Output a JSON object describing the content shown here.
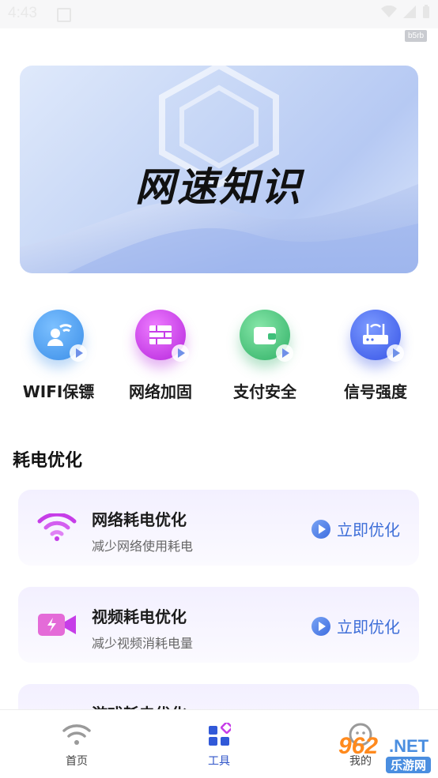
{
  "status": {
    "time": "4:43",
    "build_tag": "b5rb"
  },
  "banner": {
    "title": "网速知识"
  },
  "tools": [
    {
      "label": "WIFI保镖",
      "icon": "wifi-shield-icon",
      "color": "#4a9cf0"
    },
    {
      "label": "网络加固",
      "icon": "firewall-icon",
      "color": "#c63de8"
    },
    {
      "label": "支付安全",
      "icon": "wallet-icon",
      "color": "#3fc07a"
    },
    {
      "label": "信号强度",
      "icon": "router-icon",
      "color": "#4b6ff0"
    }
  ],
  "section": {
    "title": "耗电优化"
  },
  "cards": [
    {
      "title": "网络耗电优化",
      "subtitle": "减少网络使用耗电",
      "action": "立即优化",
      "icon": "wifi-icon"
    },
    {
      "title": "视频耗电优化",
      "subtitle": "减少视频消耗电量",
      "action": "立即优化",
      "icon": "video-icon"
    },
    {
      "title": "游戏耗电优化",
      "subtitle": "",
      "action": "",
      "icon": "game-icon"
    }
  ],
  "tabs": [
    {
      "label": "首页",
      "icon": "wifi-icon"
    },
    {
      "label": "工具",
      "icon": "grid-icon",
      "active": true
    },
    {
      "label": "我的",
      "icon": "profile-icon"
    }
  ],
  "colors": {
    "accent": "#3f6fd8",
    "active_tab": "#2f54c8"
  },
  "watermark": {
    "brand": "962",
    "domain": ".NET",
    "tagline": "乐游网"
  }
}
